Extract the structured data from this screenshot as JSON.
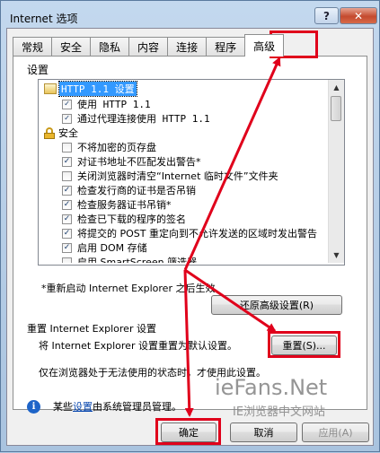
{
  "window": {
    "title": "Internet 选项",
    "help_label": "?",
    "close_label": "✕"
  },
  "tabs": [
    {
      "label": "常规"
    },
    {
      "label": "安全"
    },
    {
      "label": "隐私"
    },
    {
      "label": "内容"
    },
    {
      "label": "连接"
    },
    {
      "label": "程序"
    },
    {
      "label": "高级",
      "active": true
    }
  ],
  "settings": {
    "legend": "设置",
    "items": [
      {
        "type": "group",
        "icon": "folder-icon",
        "label": "HTTP 1.1 设置",
        "selected": true
      },
      {
        "type": "check",
        "checked": true,
        "label": "使用 HTTP 1.1"
      },
      {
        "type": "check",
        "checked": true,
        "label": "通过代理连接使用 HTTP 1.1"
      },
      {
        "type": "group",
        "icon": "lock-icon",
        "label": "安全"
      },
      {
        "type": "check",
        "checked": false,
        "label": "不将加密的页存盘"
      },
      {
        "type": "check",
        "checked": true,
        "label": "对证书地址不匹配发出警告*"
      },
      {
        "type": "check",
        "checked": false,
        "label": "关闭浏览器时清空“Internet 临时文件”文件夹"
      },
      {
        "type": "check",
        "checked": true,
        "label": "检查发行商的证书是否吊销"
      },
      {
        "type": "check",
        "checked": true,
        "label": "检查服务器证书吊销*"
      },
      {
        "type": "check",
        "checked": true,
        "label": "检查已下载的程序的签名"
      },
      {
        "type": "check",
        "checked": true,
        "label": "将提交的 POST 重定向到不允许发送的区域时发出警告"
      },
      {
        "type": "check",
        "checked": true,
        "label": "启用 DOM 存储"
      },
      {
        "type": "check",
        "checked": false,
        "label": "启用 SmartScreen 筛选器"
      }
    ]
  },
  "restart_note": "*重新启动 Internet Explorer 之后生效",
  "restore_button": "还原高级设置(R)",
  "reset": {
    "group_label": "重置 Internet Explorer 设置",
    "description": "将 Internet Explorer 设置重置为默认设置。",
    "button": "重置(S)...",
    "note": "仅在浏览器处于无法使用的状态时，才使用此设置。"
  },
  "admin_note": {
    "prefix": "某些",
    "link": "设置",
    "suffix": "由系统管理员管理。"
  },
  "buttons": {
    "ok": "确定",
    "cancel": "取消",
    "apply": "应用(A)"
  },
  "watermark": {
    "main": "ieFans.Net",
    "sub": "IE浏览器中文网站"
  },
  "colors": {
    "annotation_red": "#e0001b",
    "selection_blue": "#3399ff"
  }
}
